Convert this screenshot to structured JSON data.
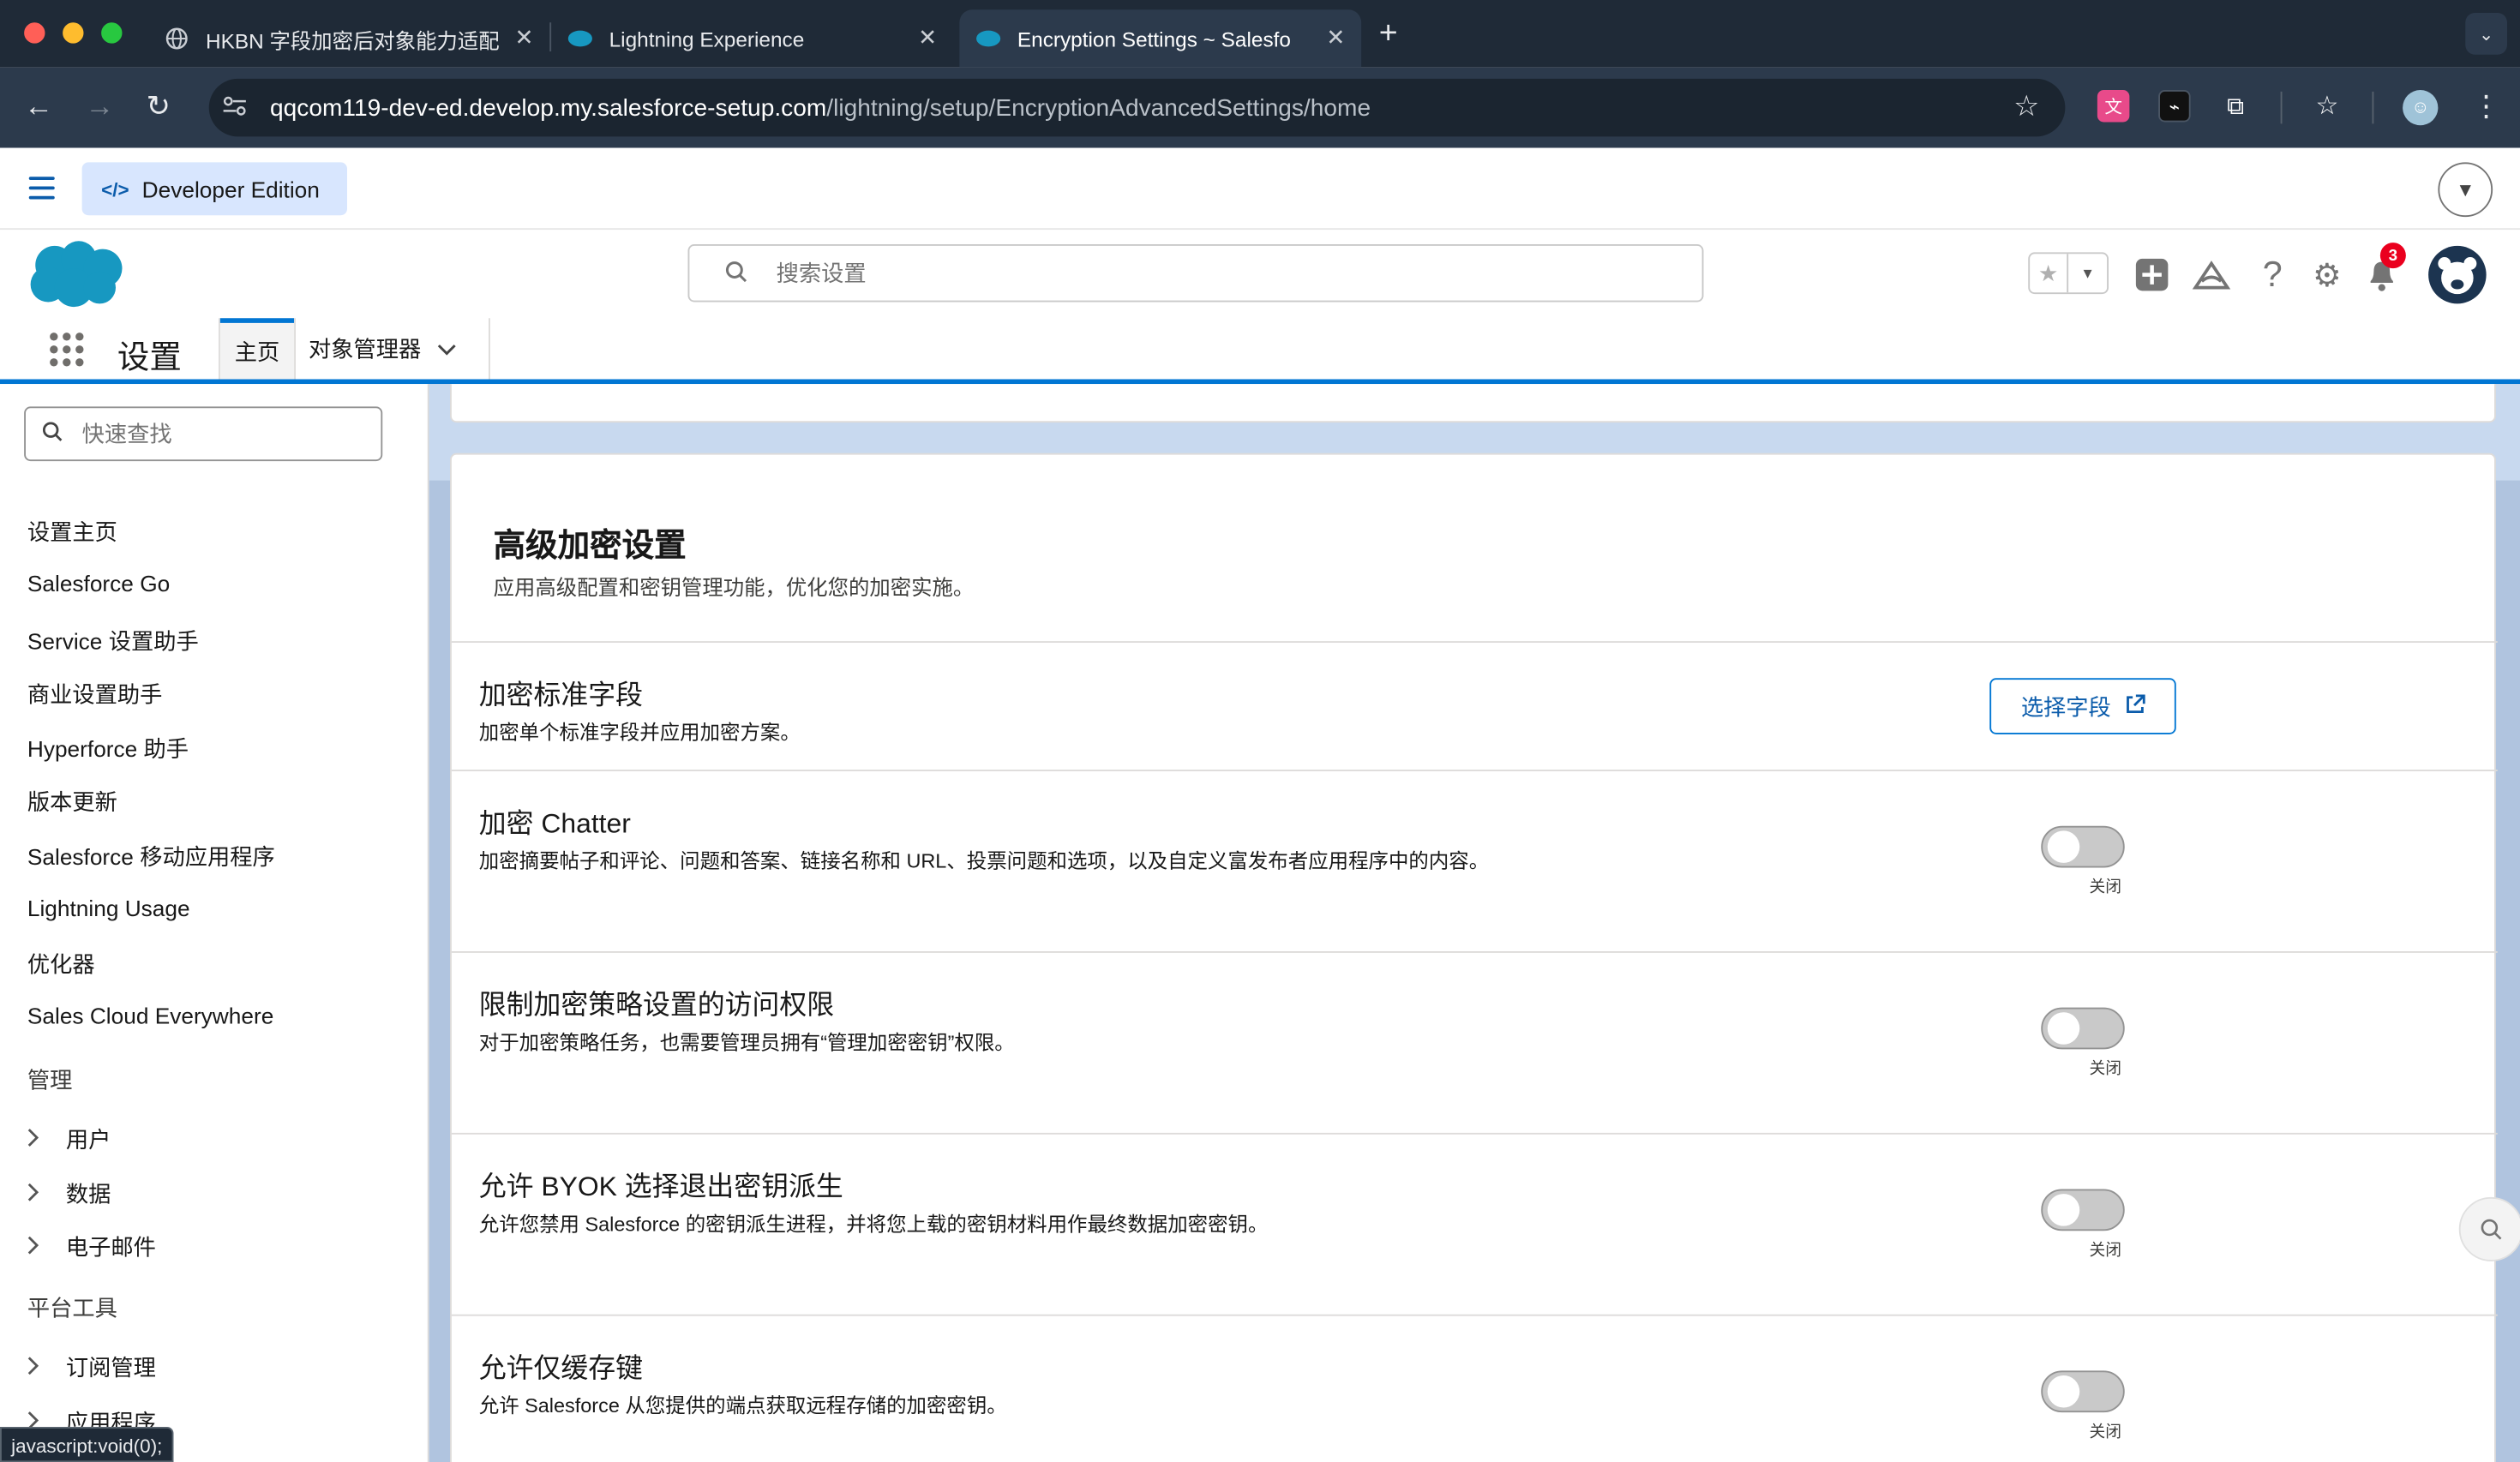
{
  "browser": {
    "tabs": [
      {
        "title": "HKBN 字段加密后对象能力适配",
        "active": false
      },
      {
        "title": "Lightning Experience",
        "active": false
      },
      {
        "title": "Encryption Settings ~ Salesfo",
        "active": true
      }
    ],
    "url_host": "qqcom119-dev-ed.develop.my.salesforce-setup.com",
    "url_path": "/lightning/setup/EncryptionAdvancedSettings/home",
    "status_url": "javascript:void(0);"
  },
  "header": {
    "edition_label": "Developer Edition",
    "search_placeholder": "搜索设置",
    "notification_count": "3"
  },
  "nav": {
    "app_name": "设置",
    "tabs": [
      {
        "label": "主页",
        "active": true
      },
      {
        "label": "对象管理器",
        "active": false
      }
    ]
  },
  "sidebar": {
    "quick_find_placeholder": "快速查找",
    "items": [
      "设置主页",
      "Salesforce Go",
      "Service 设置助手",
      "商业设置助手",
      "Hyperforce 助手",
      "版本更新",
      "Salesforce 移动应用程序",
      "Lightning Usage",
      "优化器",
      "Sales Cloud Everywhere"
    ],
    "section_admin": "管理",
    "admin_items": [
      "用户",
      "数据",
      "电子邮件"
    ],
    "section_platform": "平台工具",
    "platform_items": [
      "订阅管理",
      "应用程序"
    ]
  },
  "main": {
    "title": "高级加密设置",
    "subtitle": "应用高级配置和密钥管理功能，优化您的加密实施。",
    "settings": [
      {
        "title": "加密标准字段",
        "desc": "加密单个标准字段并应用加密方案。",
        "button": "选择字段"
      },
      {
        "title": "加密 Chatter",
        "desc": "加密摘要帖子和评论、问题和答案、链接名称和 URL、投票问题和选项，以及自定义富发布者应用程序中的内容。",
        "toggle": "关闭",
        "enabled": false
      },
      {
        "title": "限制加密策略设置的访问权限",
        "desc": "对于加密策略任务，也需要管理员拥有“管理加密密钥”权限。",
        "toggle": "关闭",
        "enabled": false
      },
      {
        "title": "允许 BYOK 选择退出密钥派生",
        "desc": "允许您禁用 Salesforce 的密钥派生进程，并将您上载的密钥材料用作最终数据加密密钥。",
        "toggle": "关闭",
        "enabled": false
      },
      {
        "title": "允许仅缓存键",
        "desc": "允许 Salesforce 从您提供的端点获取远程存储的加密密钥。",
        "toggle": "关闭",
        "enabled": false
      }
    ]
  },
  "colors": {
    "accent": "#0176d3",
    "brand_blue": "#0b5cab",
    "cloud": "#1798c1"
  },
  "icons": [
    "globe-icon",
    "salesforce-cloud-icon",
    "search-icon",
    "star-icon",
    "add-icon",
    "trailhead-icon",
    "help-icon",
    "gear-icon",
    "bell-icon",
    "external-link-icon"
  ]
}
